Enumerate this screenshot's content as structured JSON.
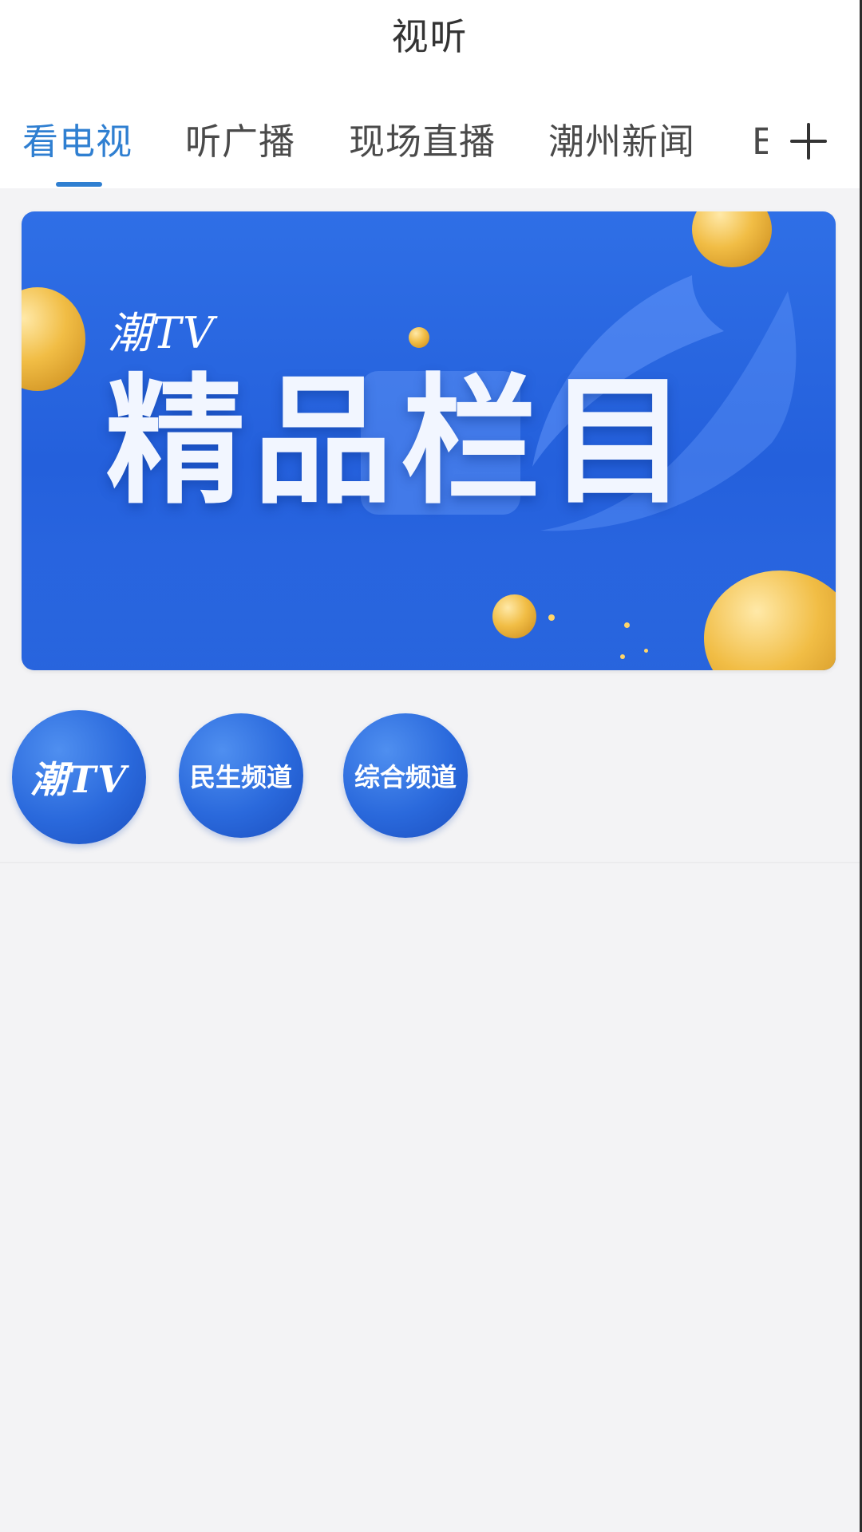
{
  "header": {
    "title": "视听"
  },
  "tabs": [
    {
      "label": "看电视",
      "active": true
    },
    {
      "label": "听广播",
      "active": false
    },
    {
      "label": "现场直播",
      "active": false
    },
    {
      "label": "潮州新闻",
      "active": false
    },
    {
      "label": "E",
      "active": false
    }
  ],
  "tab_actions": {
    "add_icon": "plus-icon"
  },
  "banner": {
    "brand": "潮TV",
    "headline": "精品栏目"
  },
  "channels": [
    {
      "label": "潮TV"
    },
    {
      "label": "民生频道"
    },
    {
      "label": "综合频道"
    }
  ],
  "colors": {
    "accent": "#2f7fd1",
    "banner_blue": "#2460dc",
    "page_bg": "#f3f3f5"
  }
}
